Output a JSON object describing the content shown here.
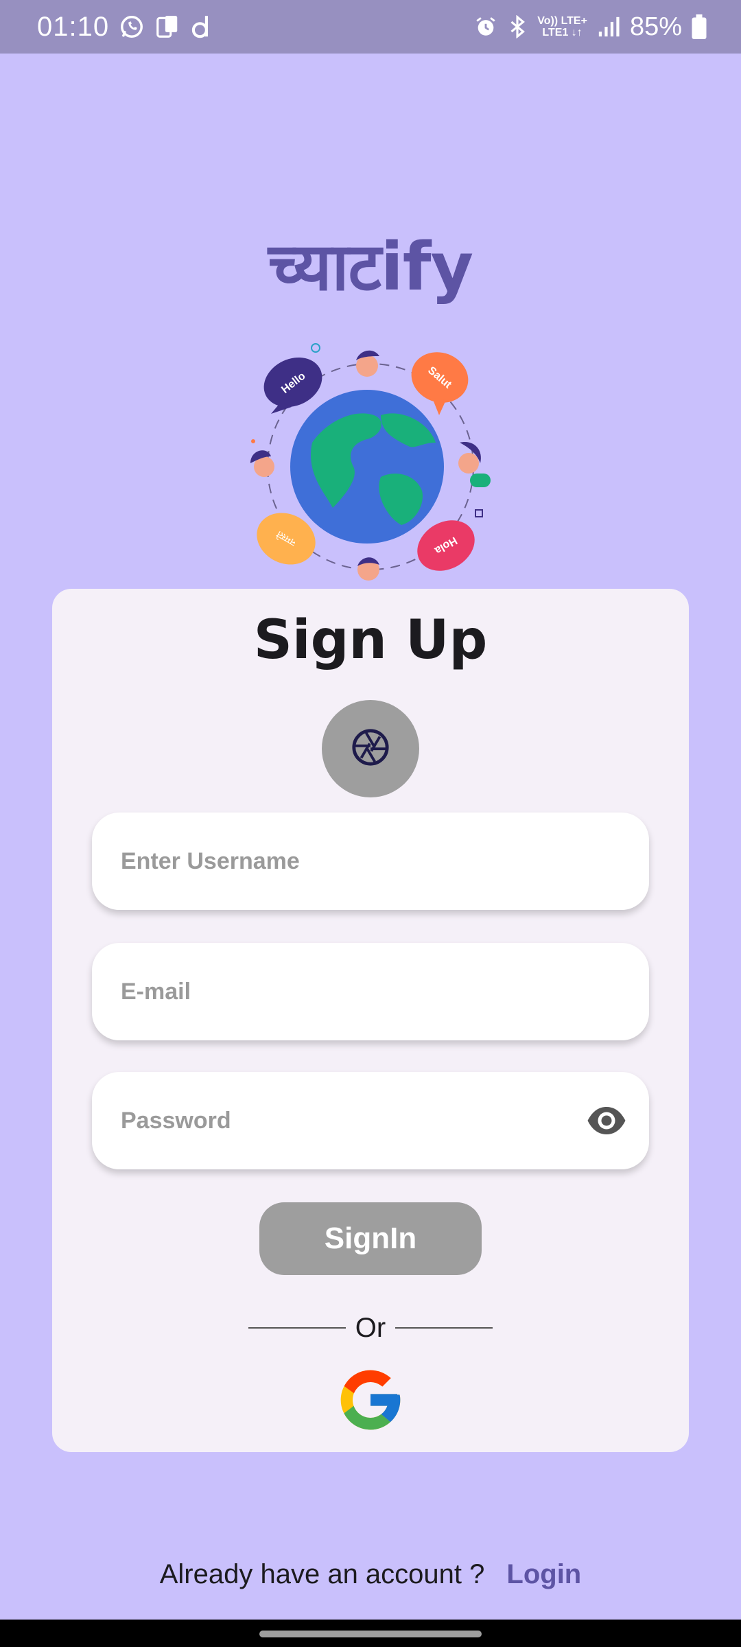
{
  "status_bar": {
    "time": "01:10",
    "net_line1": "Vo)) LTE+",
    "net_line2": "LTE1 ↓↑",
    "battery_text": "85%"
  },
  "app": {
    "title": "च्याटify"
  },
  "hero": {
    "bubbles": [
      "Hello",
      "Salut",
      "Hola",
      "नमस्ते"
    ]
  },
  "signup": {
    "title": "Sign Up",
    "username_placeholder": "Enter Username",
    "email_placeholder": "E-mail",
    "password_placeholder": "Password",
    "signin_label": "SignIn",
    "or_text": "Or"
  },
  "footer": {
    "text": "Already have an account ?",
    "login_label": "Login"
  },
  "colors": {
    "background": "#c9c0fc",
    "status_bar": "#9790c0",
    "card": "#f5f0f8",
    "accent": "#5d54a4",
    "disabled_button": "#9e9e9e"
  }
}
